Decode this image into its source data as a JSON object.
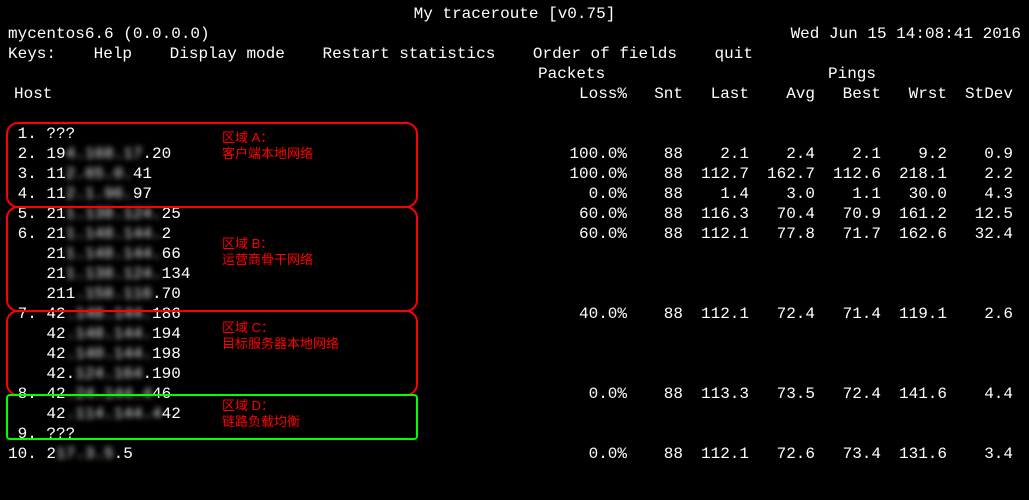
{
  "header": {
    "title": "My traceroute  [v0.75]",
    "host_line_left": "mycentos6.6 (0.0.0.0)",
    "host_line_right": "Wed Jun 15 14:08:41 2016",
    "menu": {
      "keys": "Keys:",
      "help": "Help",
      "display_mode": "Display mode",
      "restart": "Restart statistics",
      "order": "Order of fields",
      "quit": "quit"
    },
    "cat_packets": "Packets",
    "cat_pings": "Pings",
    "cols": {
      "host": "Host",
      "loss": "Loss%",
      "snt": "Snt",
      "last": "Last",
      "avg": "Avg",
      "best": "Best",
      "wrst": "Wrst",
      "stdev": "StDev"
    }
  },
  "regions": {
    "a": {
      "title": "区域 A：",
      "desc": "客户端本地网络"
    },
    "b": {
      "title": "区域 B：",
      "desc": "运营商骨干网络"
    },
    "c": {
      "title": "区域 C：",
      "desc": "目标服务器本地网络"
    },
    "d": {
      "title": "区域 D：",
      "desc": "链路负载均衡"
    }
  },
  "rows": [
    {
      "n": "1.",
      "ip_plain": "???",
      "stats": null
    },
    {
      "n": "2.",
      "ip_pre": "19",
      "ip_blur": "4.168.17",
      "ip_post": ".20",
      "stats": {
        "loss": "100.0%",
        "snt": "88",
        "last": "2.1",
        "avg": "2.4",
        "best": "2.1",
        "wrst": "9.2",
        "stdev": "0.9"
      }
    },
    {
      "n": "3.",
      "ip_pre": "11",
      "ip_blur": "2.65.0.",
      "ip_post": "41",
      "stats": {
        "loss": "100.0%",
        "snt": "88",
        "last": "112.7",
        "avg": "162.7",
        "best": "112.6",
        "wrst": "218.1",
        "stdev": "2.2"
      }
    },
    {
      "n": "4.",
      "ip_pre": "11",
      "ip_blur": "2.1.96.",
      "ip_post": "97",
      "stats": {
        "loss": "0.0%",
        "snt": "88",
        "last": "1.4",
        "avg": "3.0",
        "best": "1.1",
        "wrst": "30.0",
        "stdev": "4.3"
      }
    },
    {
      "n": "5.",
      "ip_pre": "21",
      "ip_blur": "1.138.124.",
      "ip_post": "25",
      "stats": {
        "loss": "60.0%",
        "snt": "88",
        "last": "116.3",
        "avg": "70.4",
        "best": "70.9",
        "wrst": "161.2",
        "stdev": "12.5"
      }
    },
    {
      "n": "6.",
      "ip_pre": "21",
      "ip_blur": "1.148.144.",
      "ip_post": "2",
      "stats": {
        "loss": "60.0%",
        "snt": "88",
        "last": "112.1",
        "avg": "77.8",
        "best": "71.7",
        "wrst": "162.6",
        "stdev": "32.4"
      }
    },
    {
      "n": "",
      "ip_pre": "21",
      "ip_blur": "1.148.144.",
      "ip_post": "66",
      "stats": null
    },
    {
      "n": "",
      "ip_pre": "21",
      "ip_blur": "1.138.124.",
      "ip_post": "134",
      "stats": null
    },
    {
      "n": "",
      "ip_pre": "211",
      "ip_blur": ".158.116",
      "ip_post": ".70",
      "stats": null
    },
    {
      "n": "7.",
      "ip_pre": "42",
      "ip_blur": ".148.144.",
      "ip_post": "186",
      "stats": {
        "loss": "40.0%",
        "snt": "88",
        "last": "112.1",
        "avg": "72.4",
        "best": "71.4",
        "wrst": "119.1",
        "stdev": "2.6"
      }
    },
    {
      "n": "",
      "ip_pre": "42",
      "ip_blur": ".148.144.",
      "ip_post": "194",
      "stats": null
    },
    {
      "n": "",
      "ip_pre": "42",
      "ip_blur": ".140.144.",
      "ip_post": "198",
      "stats": null
    },
    {
      "n": "",
      "ip_pre": "42.",
      "ip_blur": "124.164",
      "ip_post": ".190",
      "stats": null
    },
    {
      "n": "8.",
      "ip_pre": "42",
      "ip_blur": ".24.144.4",
      "ip_post": "46",
      "stats": {
        "loss": "0.0%",
        "snt": "88",
        "last": "113.3",
        "avg": "73.5",
        "best": "72.4",
        "wrst": "141.6",
        "stdev": "4.4"
      }
    },
    {
      "n": "",
      "ip_pre": "42",
      "ip_blur": ".114.144.4",
      "ip_post": "42",
      "stats": null
    },
    {
      "n": "9.",
      "ip_plain": "???",
      "stats": null
    },
    {
      "n": "10.",
      "ip_pre": "2",
      "ip_blur": "17.3.5",
      "ip_post": ".5",
      "stats": {
        "loss": "0.0%",
        "snt": "88",
        "last": "112.1",
        "avg": "72.6",
        "best": "73.4",
        "wrst": "131.6",
        "stdev": "3.4"
      }
    }
  ]
}
